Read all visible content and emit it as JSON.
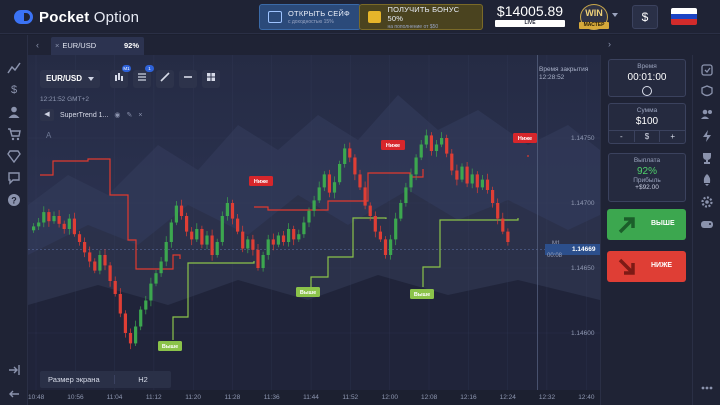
{
  "header": {
    "logo_bold": "Pocket",
    "logo_light": " Option",
    "safe_title": "ОТКРЫТЬ СЕЙФ",
    "safe_sub": "с доходностью 15%",
    "bonus_title": "ПОЛУЧИТЬ БОНУС 50%",
    "bonus_sub": "на пополнение от $50",
    "balance": "$14005.89",
    "balance_tag": "LIVE",
    "win_label": "WIN",
    "master_label": "МАСТЕР",
    "dollar_label": "$"
  },
  "tabs": [
    {
      "name": "EUR/USD",
      "payout": "92%"
    }
  ],
  "toolbar": {
    "pair": "EUR/USD",
    "timeframe_badge": "M1",
    "indicator_badge": "1"
  },
  "chart_header": {
    "time": "12:21:52 GMT+2",
    "indicator": "SuperTrend 1...",
    "letter": "A"
  },
  "chart_data": {
    "type": "line",
    "pair": "EUR/USD",
    "x_ticks": [
      "10:48",
      "10:56",
      "11:04",
      "11:12",
      "11:20",
      "11:28",
      "11:36",
      "11:44",
      "11:52",
      "12:00",
      "12:08",
      "12:16",
      "12:24",
      "12:32",
      "12:40"
    ],
    "y_ticks": [
      "1.14750",
      "1.14700",
      "1.14650",
      "1.14600"
    ],
    "current_price": "1.14669",
    "timer_label": "Время закрытия",
    "timer_value": "12:28:52",
    "bar_label": "M1",
    "countdown": "00:08",
    "signals": [
      {
        "type": "sell",
        "label": "Ниже"
      },
      {
        "type": "sell",
        "label": "Ниже"
      },
      {
        "type": "sell",
        "label": "Ниже"
      },
      {
        "type": "buy",
        "label": "Выше"
      },
      {
        "type": "buy",
        "label": "Выше"
      },
      {
        "type": "buy",
        "label": "Выше"
      }
    ]
  },
  "screen_size": {
    "label": "Размер экрана",
    "value": "H2"
  },
  "trade_panel": {
    "time_caption": "Время",
    "time_value": "00:01:00",
    "amount_caption": "Сумма",
    "amount_value": "$100",
    "minus": "-",
    "currency": "$",
    "plus": "+",
    "payout_caption": "Выплата",
    "payout_value": "92%",
    "profit_caption": "Прибыль",
    "profit_value": "+$92.00",
    "buy_label": "ВЫШЕ",
    "sell_label": "НИЖЕ"
  },
  "colors": {
    "up": "#3ca74f",
    "down": "#df3e35",
    "accent": "#2c4f8c",
    "supertrend_up": "#8bc34a",
    "supertrend_down": "#e03a2f"
  }
}
